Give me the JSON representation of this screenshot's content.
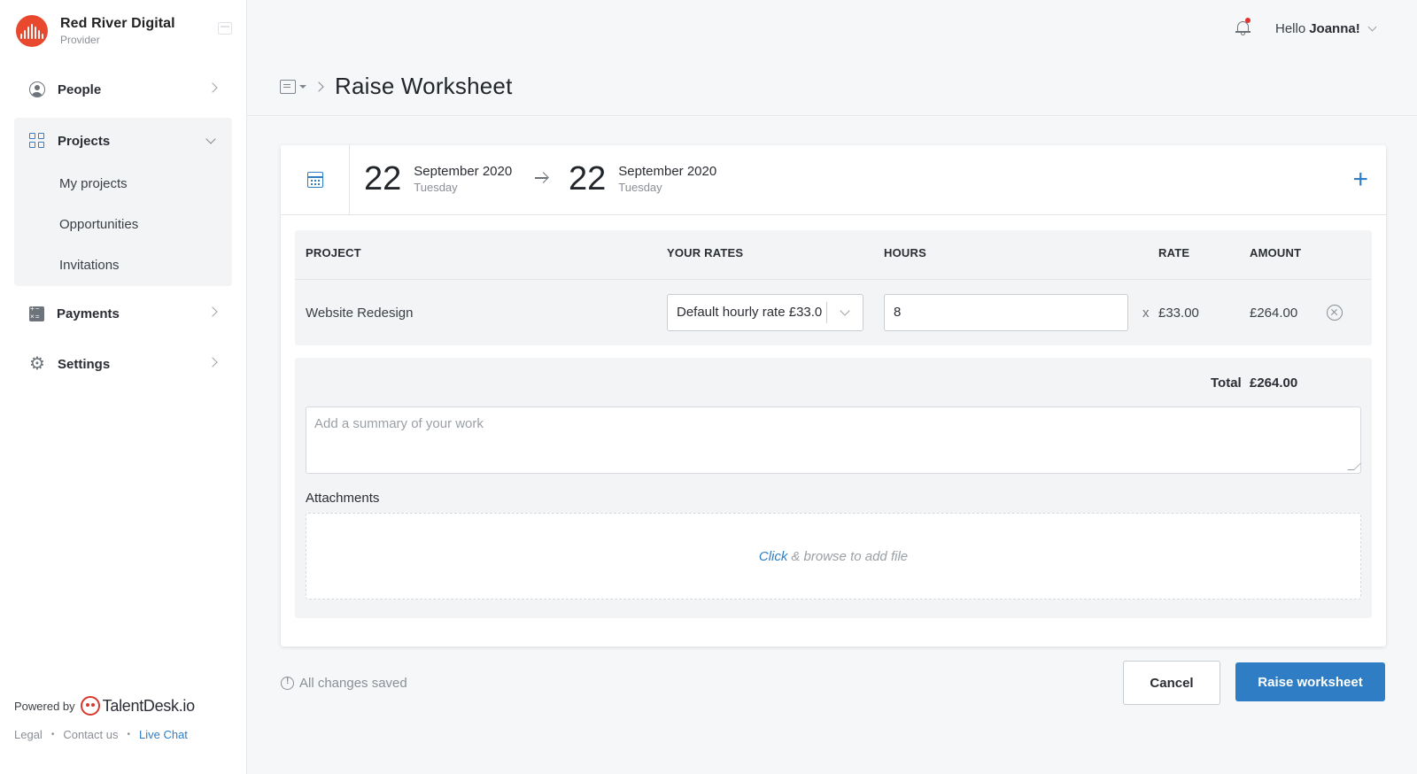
{
  "org": {
    "name": "Red River Digital",
    "role": "Provider"
  },
  "sidebar": {
    "items": [
      {
        "label": "People"
      },
      {
        "label": "Projects",
        "sub": [
          "My projects",
          "Opportunities",
          "Invitations"
        ]
      },
      {
        "label": "Payments"
      },
      {
        "label": "Settings"
      }
    ],
    "powered_by": "Powered by",
    "brand": "TalentDesk.io",
    "footer": {
      "legal": "Legal",
      "contact": "Contact us",
      "chat": "Live Chat"
    }
  },
  "header": {
    "greeting": "Hello",
    "user": "Joanna!"
  },
  "page": {
    "title": "Raise Worksheet"
  },
  "dates": {
    "start": {
      "day": "22",
      "month": "September 2020",
      "weekday": "Tuesday"
    },
    "end": {
      "day": "22",
      "month": "September 2020",
      "weekday": "Tuesday"
    }
  },
  "table": {
    "headers": {
      "project": "PROJECT",
      "rates": "YOUR RATES",
      "hours": "HOURS",
      "rate": "RATE",
      "amount": "AMOUNT"
    },
    "row": {
      "project": "Website Redesign",
      "rate_option": "Default hourly rate £33.0",
      "hours": "8",
      "times": "x",
      "rate": "£33.00",
      "amount": "£264.00"
    }
  },
  "summary": {
    "total_label": "Total",
    "total_value": "£264.00",
    "placeholder": "Add a summary of your work",
    "attachments_label": "Attachments",
    "drop_click": "Click",
    "drop_rest": "& browse to add file"
  },
  "footer_actions": {
    "saved": "All changes saved",
    "cancel": "Cancel",
    "raise": "Raise worksheet"
  },
  "colors": {
    "accent": "#2f7dc4",
    "brand_red": "#e8492e",
    "notification": "#e3322c"
  },
  "icons": [
    "collapse-icon",
    "person-icon",
    "grid-icon",
    "calculator-icon",
    "gear-icon",
    "bell-icon",
    "calendar-icon",
    "plus-icon",
    "remove-icon",
    "info-icon"
  ]
}
